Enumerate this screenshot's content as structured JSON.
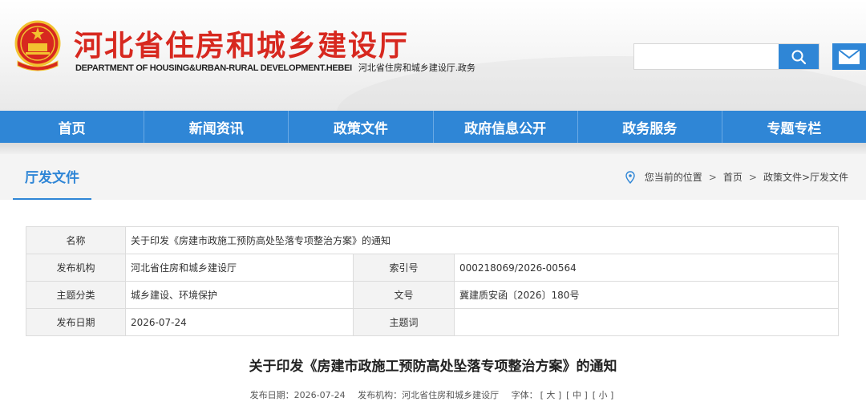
{
  "header": {
    "site_title": "河北省住房和城乡建设厅",
    "site_subtitle_en": "DEPARTMENT OF HOUSING&URBAN-RURAL DEVELOPMENT.HEBEI",
    "site_subtitle_zh": "河北省住房和城乡建设厅.政务",
    "search": {
      "placeholder": "",
      "value": ""
    },
    "icons": {
      "emblem": "national-emblem-icon",
      "search": "search-icon",
      "mail": "mail-icon"
    },
    "colors": {
      "brand_red": "#d7281f",
      "accent_blue": "#2f86d6"
    }
  },
  "nav": {
    "items": [
      {
        "label": "首页"
      },
      {
        "label": "新闻资讯"
      },
      {
        "label": "政策文件"
      },
      {
        "label": "政府信息公开"
      },
      {
        "label": "政务服务"
      },
      {
        "label": "专题专栏"
      }
    ]
  },
  "section": {
    "title": "厅发文件",
    "breadcrumb": {
      "prefix": "您当前的位置",
      "home": "首页",
      "path": "政策文件>厅发文件"
    }
  },
  "info": {
    "name_label": "名称",
    "name_value": "关于印发《房建市政施工预防高处坠落专项整治方案》的通知",
    "publisher_label": "发布机构",
    "publisher_value": "河北省住房和城乡建设厅",
    "index_label": "索引号",
    "index_value": "000218069/2026-00564",
    "category_label": "主题分类",
    "category_value": "城乡建设、环境保护",
    "docno_label": "文号",
    "docno_value": "冀建质安函〔2026〕180号",
    "date_label": "发布日期",
    "date_value": "2026-07-24",
    "keywords_label": "主题词",
    "keywords_value": ""
  },
  "article": {
    "title": "关于印发《房建市政施工预防高处坠落专项整治方案》的通知",
    "meta": {
      "date_label": "发布日期：",
      "date_value": "2026-07-24",
      "publisher_label": "发布机构：",
      "publisher_value": "河北省住房和城乡建设厅",
      "font_label": "字体：",
      "font_large": "[ 大 ]",
      "font_medium": "[ 中 ]",
      "font_small": "[ 小 ]"
    }
  }
}
